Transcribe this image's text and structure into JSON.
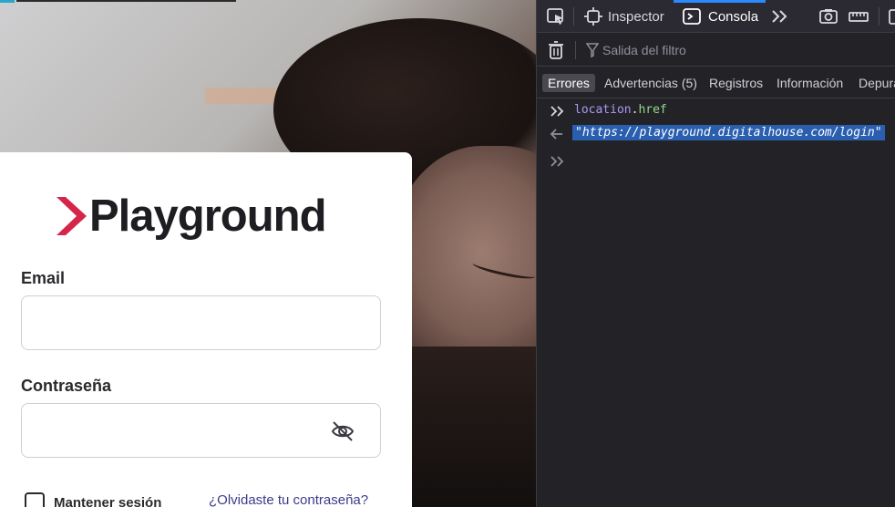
{
  "brand": {
    "name": "Playground",
    "accent_color": "#d6254a"
  },
  "login": {
    "email_label": "Email",
    "email_value": "",
    "password_label": "Contraseña",
    "password_value": "",
    "password_toggle_icon": "eye-slash-icon",
    "remember_label": "Mantener sesión",
    "forgot_link": "¿Olvidaste tu contraseña?"
  },
  "devtools": {
    "tabs": [
      {
        "label": "Inspector",
        "icon": "inspector-icon"
      },
      {
        "label": "Consola",
        "icon": "console-icon",
        "active": true
      }
    ],
    "filter_placeholder": "Salida del filtro",
    "levels": [
      {
        "label": "Errores",
        "active": true
      },
      {
        "label": "Advertencias (5)"
      },
      {
        "label": "Registros"
      },
      {
        "label": "Información"
      },
      {
        "label": "Depura"
      }
    ],
    "console": {
      "input_object": "location",
      "input_separator": ".",
      "input_property": "href",
      "output": "\"https://playground.digitalhouse.com/login\""
    },
    "accent_color": "#2b8aff"
  }
}
